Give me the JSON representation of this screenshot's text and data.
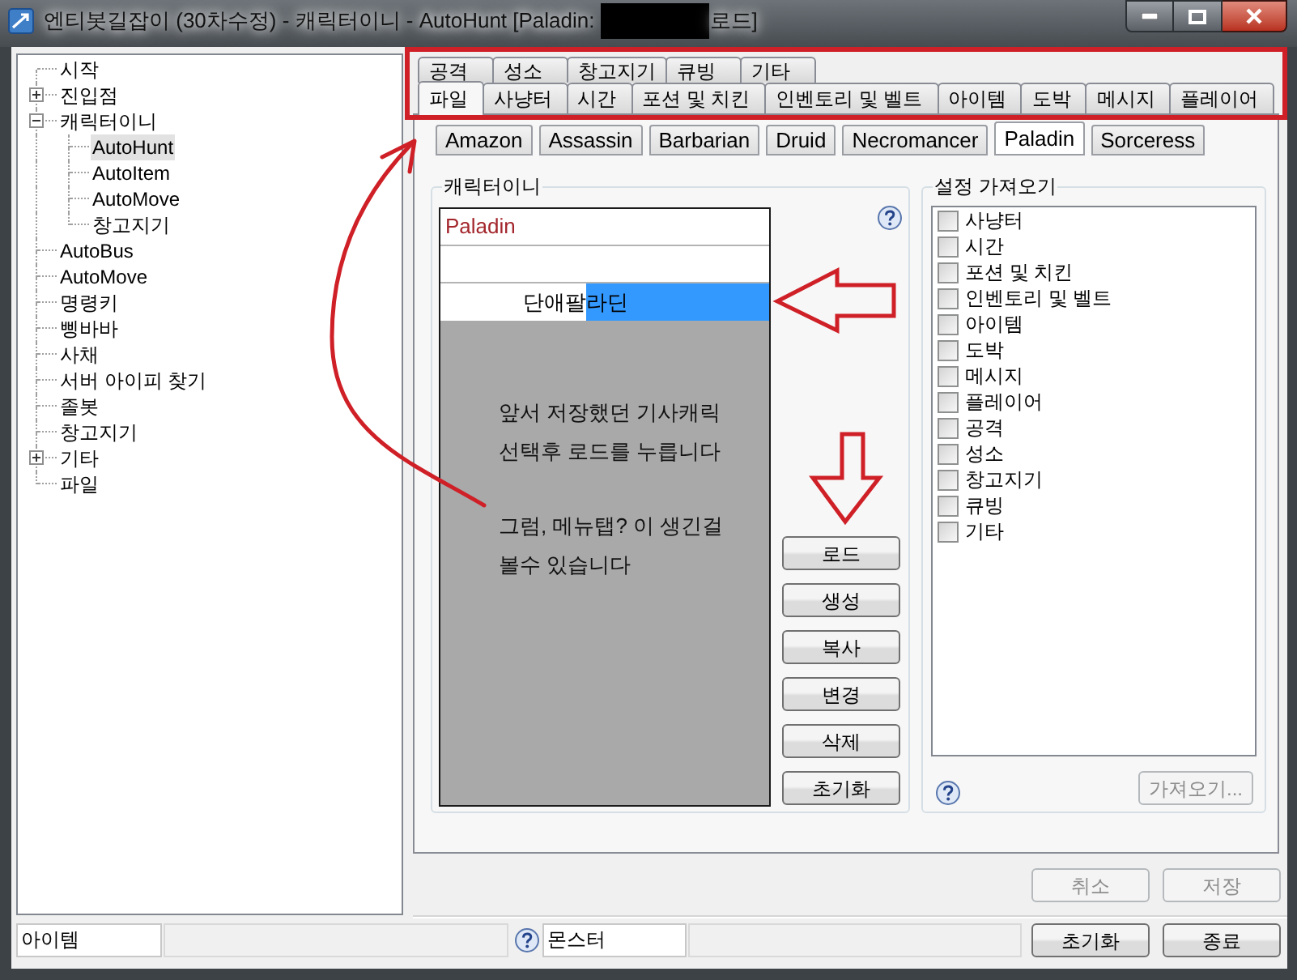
{
  "window": {
    "title": "엔티봇길잡이 (30차수정) - 캐릭터이니 - AutoHunt [Paladin:",
    "title_after_redaction": "로드]"
  },
  "tree": {
    "items": [
      {
        "label": "시작",
        "selected": false
      },
      {
        "label": "진입점",
        "selected": false,
        "expanded": false
      },
      {
        "label": "캐릭터이니",
        "selected": false,
        "expanded": true,
        "children": [
          {
            "label": "AutoHunt",
            "selected": true
          },
          {
            "label": "AutoItem",
            "selected": false
          },
          {
            "label": "AutoMove",
            "selected": false
          },
          {
            "label": "창고지기",
            "selected": false
          }
        ]
      },
      {
        "label": "AutoBus",
        "selected": false
      },
      {
        "label": "AutoMove",
        "selected": false
      },
      {
        "label": "명령키",
        "selected": false
      },
      {
        "label": "삥바바",
        "selected": false
      },
      {
        "label": "사채",
        "selected": false
      },
      {
        "label": "서버 아이피 찾기",
        "selected": false
      },
      {
        "label": "졸봇",
        "selected": false
      },
      {
        "label": "창고지기",
        "selected": false
      },
      {
        "label": "기타",
        "selected": false,
        "expanded": false
      },
      {
        "label": "파일",
        "selected": false
      }
    ]
  },
  "tab_rows": [
    [
      {
        "label": "공격",
        "selected": false
      },
      {
        "label": "성소",
        "selected": false
      },
      {
        "label": "창고지기",
        "selected": false
      },
      {
        "label": "큐빙",
        "selected": false
      },
      {
        "label": "기타",
        "selected": false
      }
    ],
    [
      {
        "label": "파일",
        "selected": true
      },
      {
        "label": "사냥터",
        "selected": false
      },
      {
        "label": "시간",
        "selected": false
      },
      {
        "label": "포션 및 치킨",
        "selected": false
      },
      {
        "label": "인벤토리 및 벨트",
        "selected": false
      },
      {
        "label": "아이템",
        "selected": false
      },
      {
        "label": "도박",
        "selected": false
      },
      {
        "label": "메시지",
        "selected": false
      },
      {
        "label": "플레이어",
        "selected": false
      }
    ]
  ],
  "class_tabs": [
    {
      "label": "Amazon",
      "selected": false
    },
    {
      "label": "Assassin",
      "selected": false
    },
    {
      "label": "Barbarian",
      "selected": false
    },
    {
      "label": "Druid",
      "selected": false
    },
    {
      "label": "Necromancer",
      "selected": false
    },
    {
      "label": "Paladin",
      "selected": true
    },
    {
      "label": "Sorceress",
      "selected": false
    }
  ],
  "character_group": {
    "title": "캐릭터이니",
    "list": [
      {
        "kind": "header",
        "label": "Paladin",
        "selected": false
      },
      {
        "kind": "blank",
        "selected": false
      },
      {
        "kind": "entry",
        "label": "단애팔라딘",
        "selected": true
      }
    ],
    "note": [
      [
        "앞서 저장했던 기사캐릭",
        "선택후 로드를 누릅니다"
      ],
      [
        "그럼, 메뉴탭? 이 생긴걸",
        "볼수 있습니다"
      ]
    ],
    "buttons": [
      "로드",
      "생성",
      "복사",
      "변경",
      "삭제",
      "초기화"
    ]
  },
  "import_group": {
    "title": "설정 가져오기",
    "options": [
      {
        "label": "사냥터",
        "checked": false
      },
      {
        "label": "시간",
        "checked": false
      },
      {
        "label": "포션 및 치킨",
        "checked": false
      },
      {
        "label": "인벤토리 및 벨트",
        "checked": false
      },
      {
        "label": "아이템",
        "checked": false
      },
      {
        "label": "도박",
        "checked": false
      },
      {
        "label": "메시지",
        "checked": false
      },
      {
        "label": "플레이어",
        "checked": false
      },
      {
        "label": "공격",
        "checked": false
      },
      {
        "label": "성소",
        "checked": false
      },
      {
        "label": "창고지기",
        "checked": false
      },
      {
        "label": "큐빙",
        "checked": false
      },
      {
        "label": "기타",
        "checked": false
      }
    ],
    "button": {
      "label": "가져오기...",
      "disabled": true
    }
  },
  "actions": [
    {
      "label": "취소",
      "disabled": true
    },
    {
      "label": "저장",
      "disabled": true
    }
  ],
  "status_bar": {
    "item_field": "아이템",
    "monster_field": "몬스터",
    "buttons": [
      "초기화",
      "종료"
    ]
  }
}
